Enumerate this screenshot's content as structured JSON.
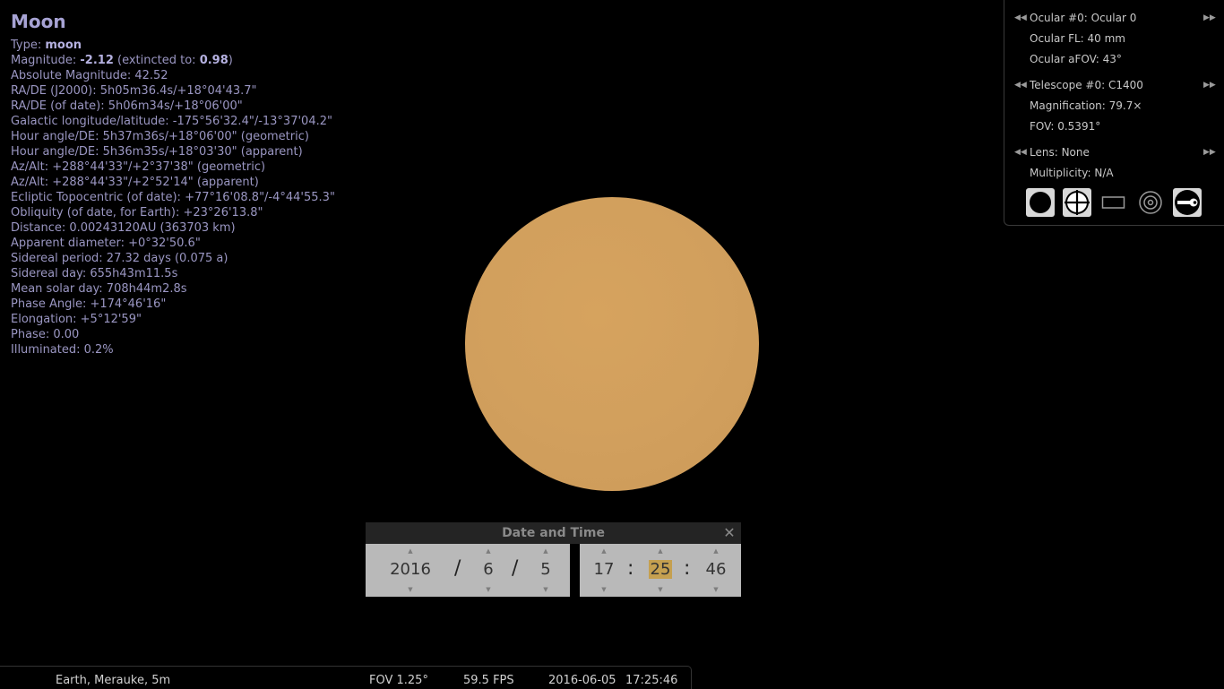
{
  "info": {
    "title": "Moon",
    "type_label": "Type: ",
    "type_value": "moon",
    "magnitude_label": "Magnitude: ",
    "magnitude_value": "-2.12",
    "magnitude_ext_label": " (extincted to: ",
    "magnitude_ext_value": "0.98",
    "magnitude_close": ")",
    "lines": [
      "Absolute Magnitude: 42.52",
      "RA/DE (J2000): 5h05m36.4s/+18°04'43.7\"",
      "RA/DE (of date): 5h06m34s/+18°06'00\"",
      "Galactic longitude/latitude: -175°56'32.4\"/-13°37'04.2\"",
      "Hour angle/DE: 5h37m36s/+18°06'00\" (geometric)",
      "Hour angle/DE: 5h36m35s/+18°03'30\" (apparent)",
      "Az/Alt: +288°44'33\"/+2°37'38\" (geometric)",
      "Az/Alt: +288°44'33\"/+2°52'14\" (apparent)",
      "Ecliptic Topocentric (of date): +77°16'08.8\"/-4°44'55.3\"",
      "Obliquity (of date, for Earth): +23°26'13.8\"",
      "Distance: 0.00243120AU (363703 km)",
      "Apparent diameter: +0°32'50.6\"",
      "Sidereal period: 27.32 days (0.075 a)",
      "Sidereal day: 655h43m11.5s",
      "Mean solar day: 708h44m2.8s",
      "Phase Angle: +174°46'16\"",
      "Elongation: +5°12'59\"",
      "Phase: 0.00",
      "Illuminated: 0.2%"
    ]
  },
  "oculars": {
    "ocular": "Ocular #0: Ocular 0",
    "ocular_fl": "Ocular FL: 40 mm",
    "ocular_afov": "Ocular aFOV: 43°",
    "telescope": "Telescope #0: C1400",
    "magnification": "Magnification: 79.7×",
    "fov": "FOV: 0.5391°",
    "lens": "Lens: None",
    "multiplicity": "Multiplicity: N/A"
  },
  "datetime": {
    "title": "Date and Time",
    "close": "✕",
    "year": "2016",
    "month": "6",
    "day": "5",
    "hour": "17",
    "minute": "25",
    "second": "46",
    "date_sep": "/",
    "time_sep": ":",
    "up_glyph": "▲",
    "down_glyph": "▼"
  },
  "statusbar": {
    "location": "Earth, Merauke, 5m",
    "fov": "FOV 1.25°",
    "fps": "59.5 FPS",
    "date": "2016-06-05",
    "time": "17:25:46"
  },
  "colors": {
    "moon": "#d2a05e",
    "info_text": "#9a96c2",
    "highlight": "#c5a050"
  }
}
